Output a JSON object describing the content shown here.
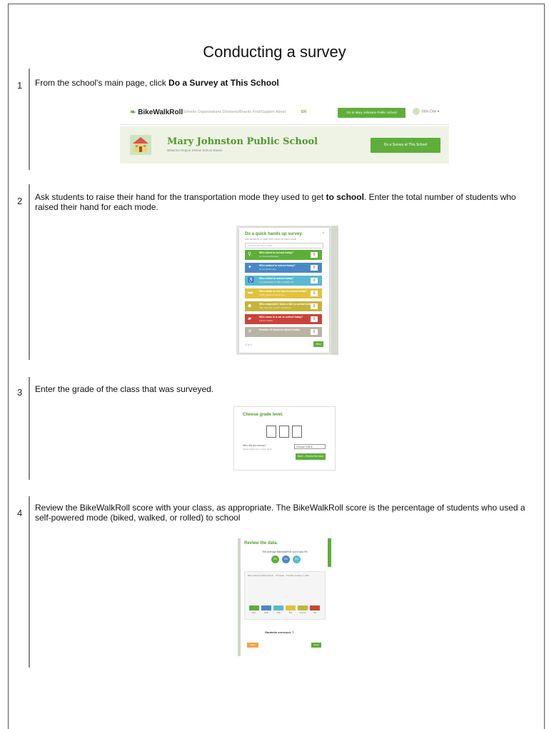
{
  "title": "Conducting a survey",
  "steps": [
    {
      "number": "1",
      "text_pre": "From the school's main page, click ",
      "text_bold": "Do a Survey at This School",
      "text_post": ""
    },
    {
      "number": "2",
      "text_pre": "Ask students to raise their hand for the transportation mode they used to get ",
      "text_bold": "to school",
      "text_post": ". Enter the total number of students who raised their hand for each mode."
    },
    {
      "number": "3",
      "text": "Enter the grade of the class that was surveyed."
    },
    {
      "number": "4",
      "text": "Review the BikeWalkRoll score with your class, as appropriate. The BikeWalkRoll score is the percentage of students who used a self-powered mode (biked, walked, or rolled) to school"
    }
  ],
  "shot1": {
    "logo": "BikeWalkRoll",
    "nav_links": "Schools  Organizations  Divisions/Boards  Find/Support  About",
    "lang": "EN",
    "nav_button": "Go to Mary Johnston Public School",
    "user": "John Doe",
    "school_name": "Mary Johnston Public School",
    "school_sub": "Waterloo Region District School Board",
    "cta": "Do a Survey at This School",
    "colors": {
      "accent": "#5fae3a",
      "banner": "#eef3e6"
    }
  },
  "shot2": {
    "title": "Do a quick hands up survey.",
    "subtitle": "Ask students to raise their hand for each mode",
    "select": "Thursday January 7, 2016",
    "rows": [
      {
        "icon": "bike-icon",
        "glyph": "⚲",
        "color": "#5fae3a",
        "q": "Who biked to school today?",
        "h": "Or scootered/skated",
        "count": "0"
      },
      {
        "icon": "walk-icon",
        "glyph": "✦",
        "color": "#4a88c7",
        "q": "Who walked to school today?",
        "h": "Or ran all the way",
        "count": "0"
      },
      {
        "icon": "roll-icon",
        "glyph": "♿",
        "color": "#5ab9cf",
        "q": "Who rolled to school today?",
        "h": "In a wheelchair or with a mobility aid",
        "count": "0"
      },
      {
        "icon": "bus-icon",
        "glyph": "▬",
        "color": "#e2c23c",
        "q": "Who came on the bus to school today?",
        "h": "Public transit or school bus",
        "count": "0"
      },
      {
        "icon": "carpool-icon",
        "glyph": "◆",
        "color": "#c5b43a",
        "q": "Who carpooled / took a ride to school today?",
        "h": "With kids from another household",
        "count": "0"
      },
      {
        "icon": "car-icon",
        "glyph": "▰",
        "color": "#c9433a",
        "q": "Who came in a car to school today?",
        "h": "Family vehicle",
        "count": "0"
      },
      {
        "icon": "other-icon",
        "glyph": "✕",
        "color": "#b9b3a4",
        "q": "Number of students absent today",
        "h": "",
        "count": "0"
      }
    ],
    "footer": "1 of 2",
    "next": "Next"
  },
  "shot3": {
    "title": "Choose grade level.",
    "question": "Who did you survey?",
    "question_sub": "Select grade from a drop down",
    "select": "Choose One",
    "button": "Next – Review the data"
  },
  "shot4": {
    "title": "Review the data.",
    "score_text": "The average BikeWalkRoll score was 0%",
    "circles": [
      {
        "label": "0%",
        "color": "#5fae3a"
      },
      {
        "label": "0%",
        "color": "#4a88c7"
      },
      {
        "label": "0%",
        "color": "#5ab9cf"
      }
    ],
    "panel_caption": "Mary Johnston Public School · 7th Grade · Thursday January 7, 2016",
    "modes": [
      {
        "label": "Bike",
        "color": "#5fae3a"
      },
      {
        "label": "Walk",
        "color": "#4a88c7"
      },
      {
        "label": "Roll",
        "color": "#5ab9cf"
      },
      {
        "label": "Bus",
        "color": "#e2c23c"
      },
      {
        "label": "Carpool",
        "color": "#c5b43a"
      },
      {
        "label": "Car",
        "color": "#c9433a"
      }
    ],
    "surveyed": "Students surveyed: 7",
    "back": "Back",
    "done": "Done"
  }
}
